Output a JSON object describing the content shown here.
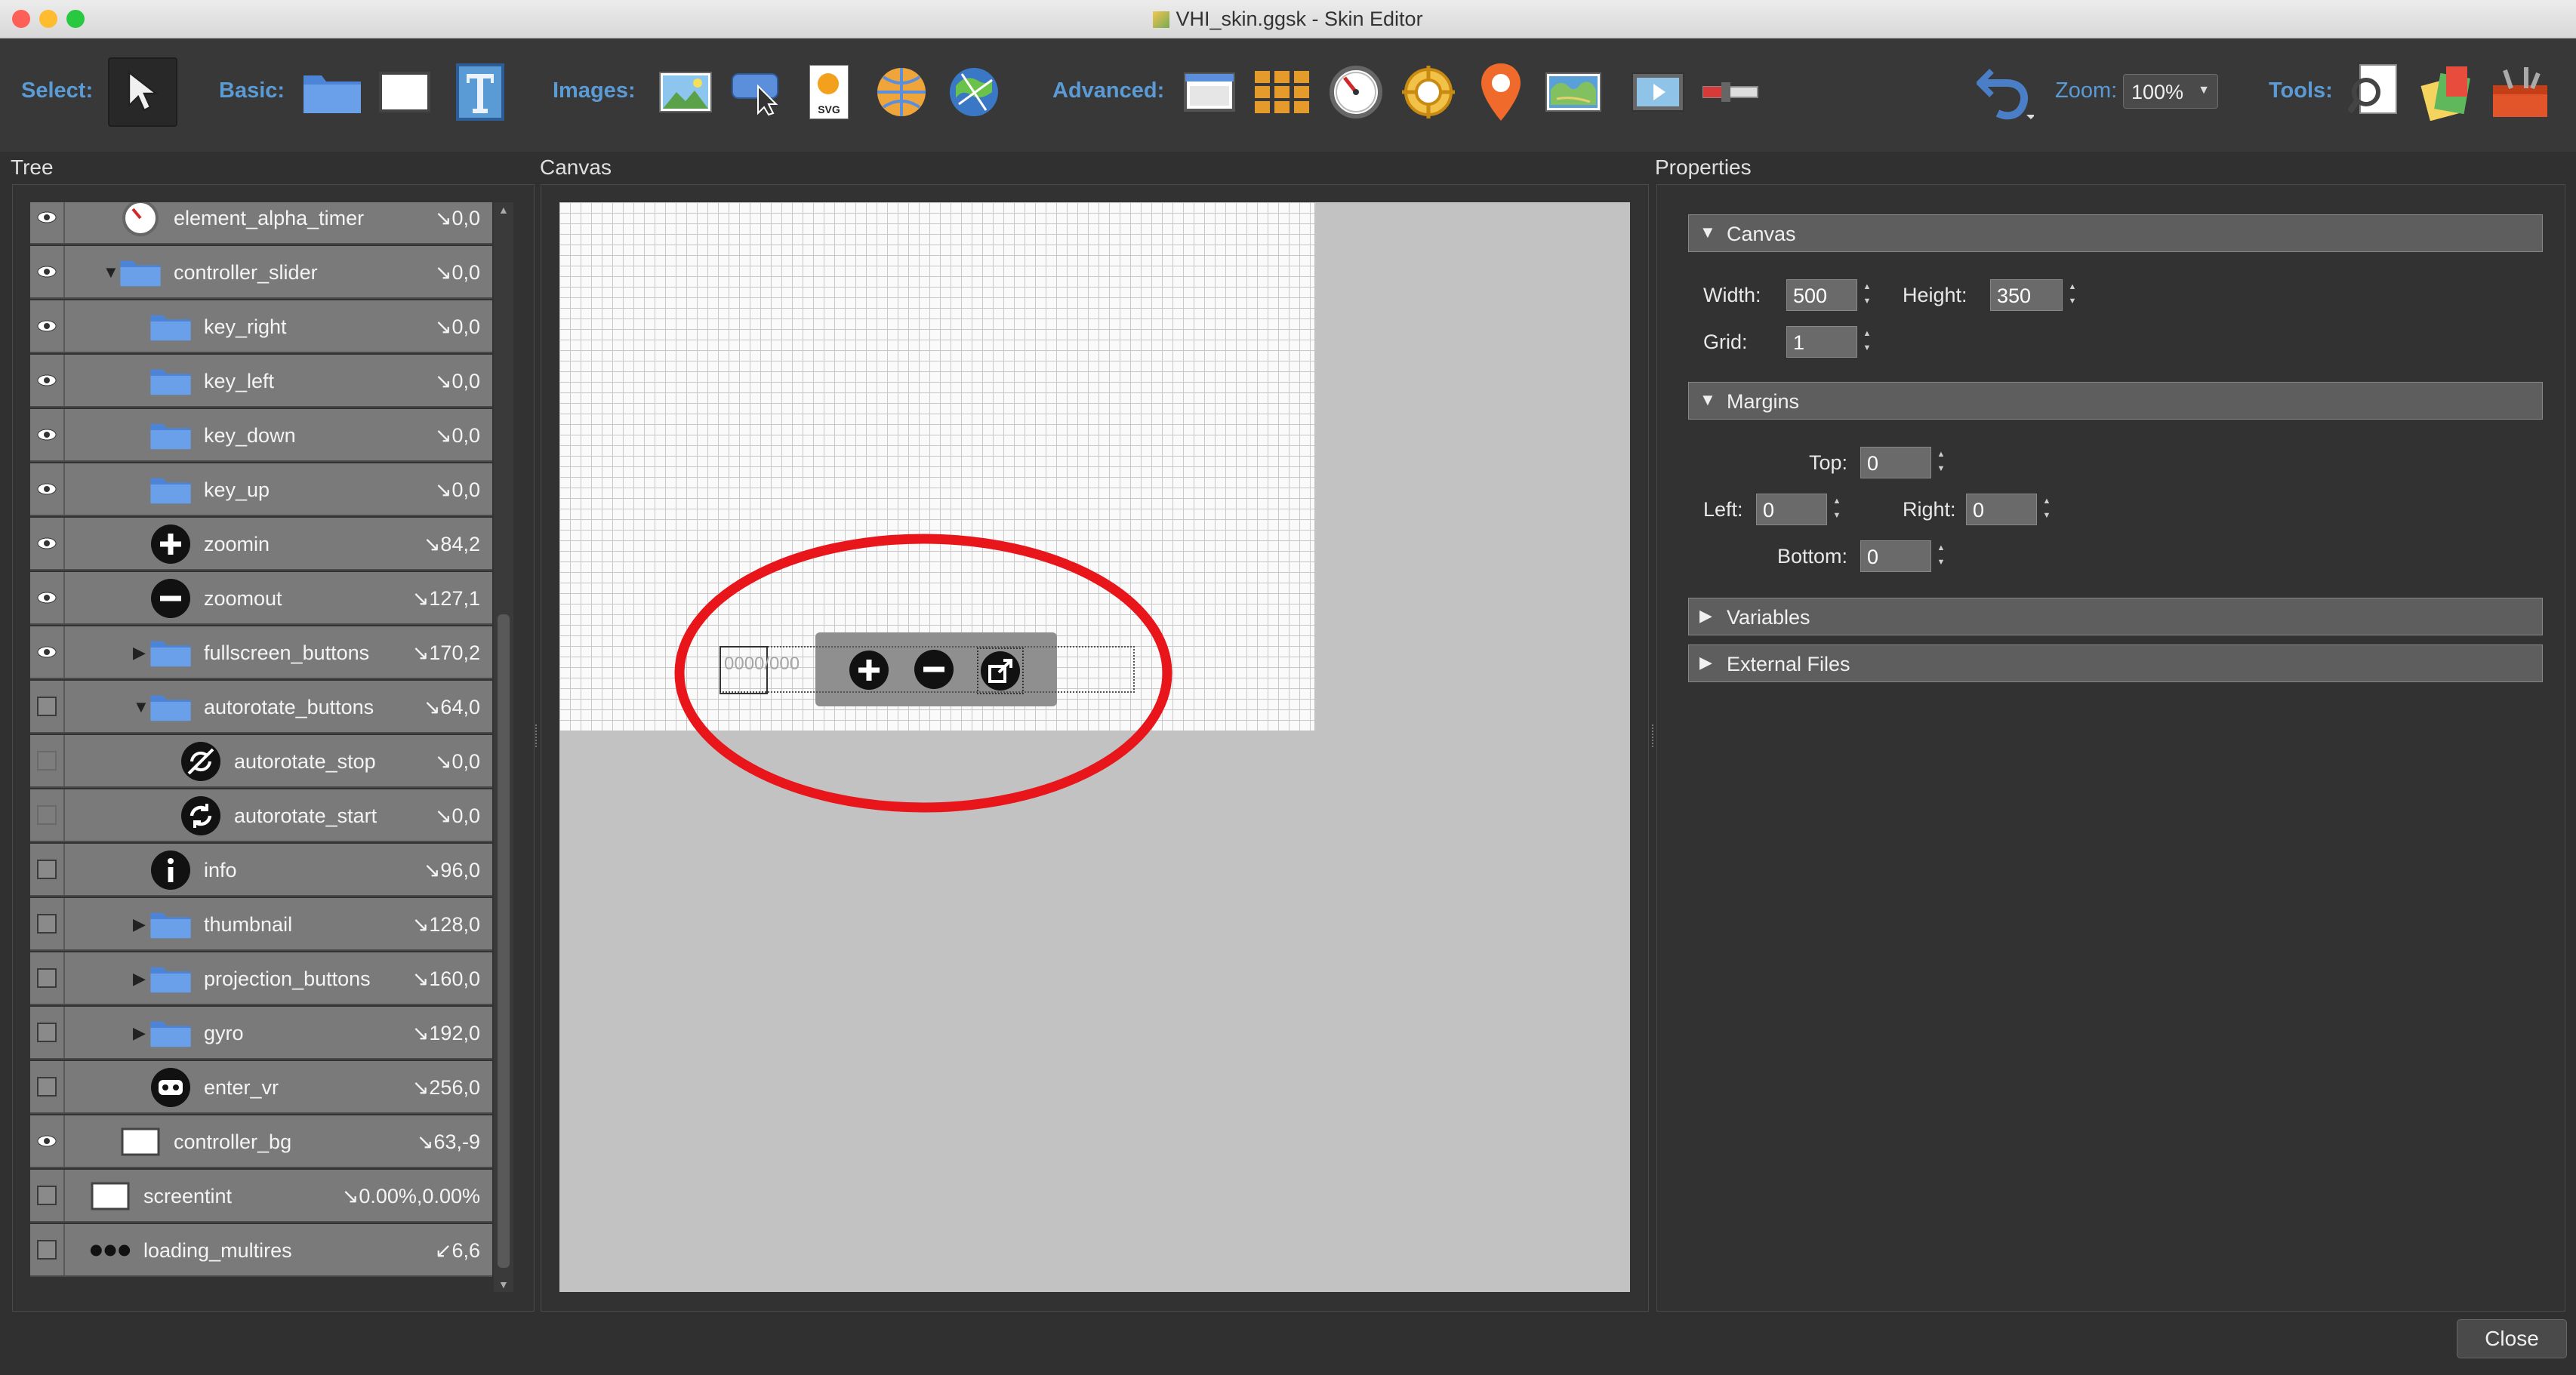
{
  "window": {
    "title": "VHI_skin.ggsk - Skin Editor"
  },
  "toolbar": {
    "select_label": "Select:",
    "basic_label": "Basic:",
    "images_label": "Images:",
    "advanced_label": "Advanced:",
    "zoom_label": "Zoom:",
    "zoom_value": "100%",
    "tools_label": "Tools:",
    "svg_label": "SVG"
  },
  "panels": {
    "tree": "Tree",
    "canvas": "Canvas",
    "properties": "Properties"
  },
  "tree": {
    "rows": [
      {
        "name": "element_alpha_timer",
        "pos": "↘0,0"
      },
      {
        "name": "controller_slider",
        "pos": "↘0,0"
      },
      {
        "name": "key_right",
        "pos": "↘0,0"
      },
      {
        "name": "key_left",
        "pos": "↘0,0"
      },
      {
        "name": "key_down",
        "pos": "↘0,0"
      },
      {
        "name": "key_up",
        "pos": "↘0,0"
      },
      {
        "name": "zoomin",
        "pos": "↘84,2"
      },
      {
        "name": "zoomout",
        "pos": "↘127,1"
      },
      {
        "name": "fullscreen_buttons",
        "pos": "↘170,2"
      },
      {
        "name": "autorotate_buttons",
        "pos": "↘64,0"
      },
      {
        "name": "autorotate_stop",
        "pos": "↘0,0"
      },
      {
        "name": "autorotate_start",
        "pos": "↘0,0"
      },
      {
        "name": "info",
        "pos": "↘96,0"
      },
      {
        "name": "thumbnail",
        "pos": "↘128,0"
      },
      {
        "name": "projection_buttons",
        "pos": "↘160,0"
      },
      {
        "name": "gyro",
        "pos": "↘192,0"
      },
      {
        "name": "enter_vr",
        "pos": "↘256,0"
      },
      {
        "name": "controller_bg",
        "pos": "↘63,-9"
      },
      {
        "name": "screentint",
        "pos": "↘0.00%,0.00%"
      },
      {
        "name": "loading_multires",
        "pos": "↙6,6"
      }
    ]
  },
  "canvas_preview": {
    "ghost_text": "0000/000"
  },
  "properties": {
    "canvas_section": "Canvas",
    "width_label": "Width:",
    "width_value": "500",
    "height_label": "Height:",
    "height_value": "350",
    "grid_label": "Grid:",
    "grid_value": "1",
    "margins_section": "Margins",
    "top_label": "Top:",
    "top_value": "0",
    "left_label": "Left:",
    "left_value": "0",
    "right_label": "Right:",
    "right_value": "0",
    "bottom_label": "Bottom:",
    "bottom_value": "0",
    "variables_section": "Variables",
    "external_files_section": "External Files"
  },
  "footer": {
    "close_label": "Close"
  },
  "colors": {
    "accent": "#5b9bd5",
    "annotation": "#e8151b",
    "folder": "#5b8fdc"
  }
}
